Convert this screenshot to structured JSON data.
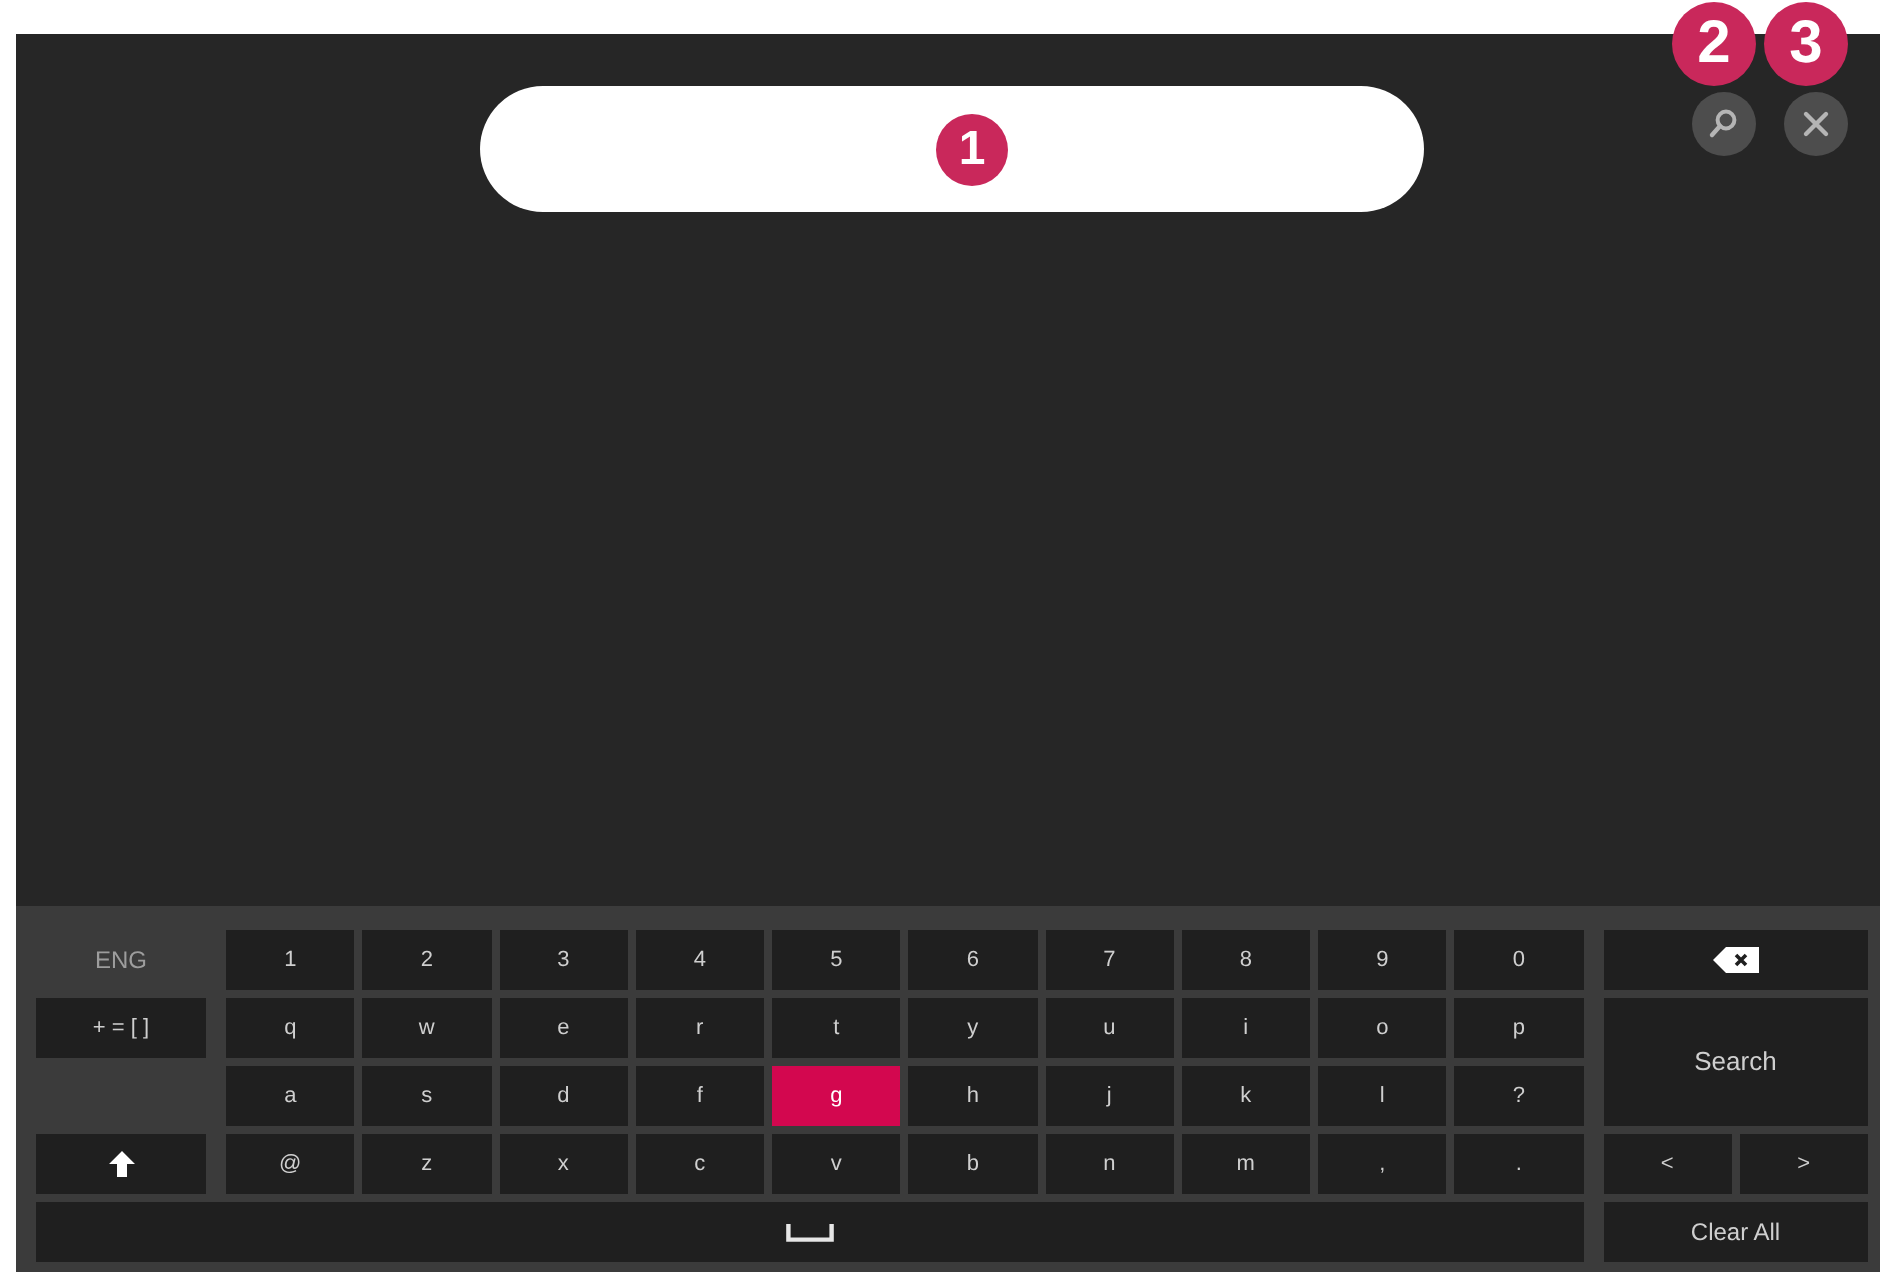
{
  "search_field": {
    "callout": "1"
  },
  "top_buttons": [
    {
      "kind": "search",
      "callout": "2"
    },
    {
      "kind": "close",
      "callout": "3"
    }
  ],
  "keyboard": {
    "language": "ENG",
    "left_keys": [
      {
        "kind": "symbols",
        "label": "+ = [ ]",
        "selected": false
      },
      {
        "kind": "shift",
        "selected": false
      }
    ],
    "rows": [
      [
        {
          "label": "1",
          "selected": false
        },
        {
          "label": "2",
          "selected": false
        },
        {
          "label": "3",
          "selected": false
        },
        {
          "label": "4",
          "selected": false
        },
        {
          "label": "5",
          "selected": false
        },
        {
          "label": "6",
          "selected": false
        },
        {
          "label": "7",
          "selected": false
        },
        {
          "label": "8",
          "selected": false
        },
        {
          "label": "9",
          "selected": false
        },
        {
          "label": "0",
          "selected": false
        }
      ],
      [
        {
          "label": "q",
          "selected": false
        },
        {
          "label": "w",
          "selected": false
        },
        {
          "label": "e",
          "selected": false
        },
        {
          "label": "r",
          "selected": false
        },
        {
          "label": "t",
          "selected": false
        },
        {
          "label": "y",
          "selected": false
        },
        {
          "label": "u",
          "selected": false
        },
        {
          "label": "i",
          "selected": false
        },
        {
          "label": "o",
          "selected": false
        },
        {
          "label": "p",
          "selected": false
        }
      ],
      [
        {
          "label": "a",
          "selected": false
        },
        {
          "label": "s",
          "selected": false
        },
        {
          "label": "d",
          "selected": false
        },
        {
          "label": "f",
          "selected": false
        },
        {
          "label": "g",
          "selected": true
        },
        {
          "label": "h",
          "selected": false
        },
        {
          "label": "j",
          "selected": false
        },
        {
          "label": "k",
          "selected": false
        },
        {
          "label": "l",
          "selected": false
        },
        {
          "label": "?",
          "selected": false
        }
      ],
      [
        {
          "label": "@",
          "selected": false
        },
        {
          "label": "z",
          "selected": false
        },
        {
          "label": "x",
          "selected": false
        },
        {
          "label": "c",
          "selected": false
        },
        {
          "label": "v",
          "selected": false
        },
        {
          "label": "b",
          "selected": false
        },
        {
          "label": "n",
          "selected": false
        },
        {
          "label": "m",
          "selected": false
        },
        {
          "label": ",",
          "selected": false
        },
        {
          "label": ".",
          "selected": false
        }
      ]
    ],
    "space_key": {
      "selected": false
    },
    "right_keys": [
      {
        "kind": "backspace",
        "selected": false
      },
      {
        "kind": "search",
        "label": "Search",
        "selected": false
      },
      {
        "kind": "left",
        "label": "<",
        "selected": false
      },
      {
        "kind": "right",
        "label": ">",
        "selected": false
      },
      {
        "kind": "clear",
        "label": "Clear All",
        "selected": false
      }
    ]
  }
}
